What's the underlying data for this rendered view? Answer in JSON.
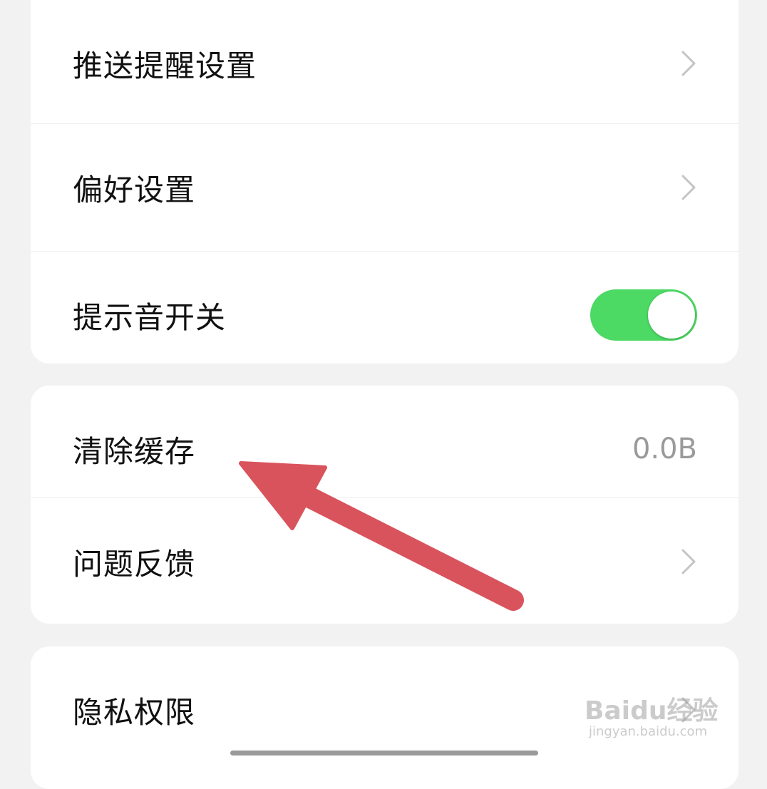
{
  "settings": {
    "group1": {
      "push_reminder_label": "推送提醒设置",
      "preferences_label": "偏好设置",
      "sound_toggle_label": "提示音开关",
      "sound_toggle_on": true
    },
    "group2": {
      "clear_cache_label": "清除缓存",
      "cache_size": "0.0B",
      "feedback_label": "问题反馈"
    },
    "group3": {
      "privacy_label": "隐私权限"
    }
  },
  "overlay": {
    "annotation": "red-arrow-pointing-to-clear-cache"
  },
  "watermark": {
    "brand": "Baidu经验",
    "url": "jingyan.baidu.com"
  },
  "colors": {
    "toggle_on": "#4cd964",
    "arrow": "#d9535c",
    "background": "#f2f2f2",
    "card": "#ffffff"
  }
}
